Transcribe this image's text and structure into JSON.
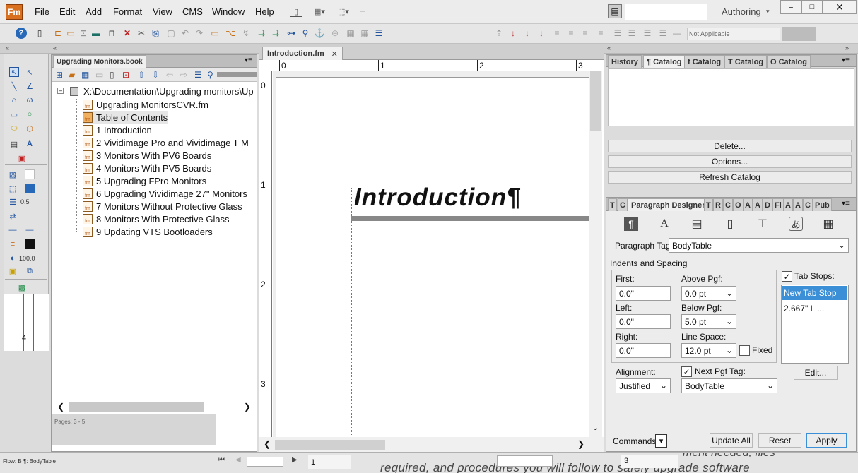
{
  "menubar": {
    "logo": "Fm",
    "items": [
      "File",
      "Edit",
      "Add",
      "Format",
      "View",
      "CMS",
      "Window",
      "Help"
    ],
    "workspace": "Authoring"
  },
  "toolbar": {
    "not_applicable": "Not Applicable"
  },
  "book": {
    "tab_label": "Upgrading Monitors.book",
    "root": "X:\\Documentation\\Upgrading monitors\\Up",
    "items": [
      "Upgrading MonitorsCVR.fm",
      "Table of Contents",
      "1 Introduction",
      "2 Vividimage Pro and Vividimage T M",
      "3 Monitors With PV6 Boards",
      "4 Monitors With PV5 Boards",
      "5 Upgrading FPro Monitors",
      "6 Upgrading Vividimage 27\" Monitors",
      "7 Monitors Without Protective Glass",
      "8 Monitors With Protective Glass",
      "9 Updating VTS Bootloaders"
    ],
    "status": "Pages: 3 - 5"
  },
  "tools": {
    "line_width": "0.5",
    "zoom": "100.0",
    "ruler_mark": "4"
  },
  "document": {
    "tab_label": "Introduction.fm",
    "ruler_h": [
      "0",
      "1",
      "2",
      "3"
    ],
    "ruler_v": [
      "0",
      "1",
      "2",
      "3"
    ],
    "heading": "Introduction¶"
  },
  "right_top": {
    "tabs": [
      "History",
      "¶ Catalog",
      "f Catalog",
      "T Catalog",
      "O Catalog"
    ],
    "buttons": [
      "Delete...",
      "Options...",
      "Refresh Catalog"
    ]
  },
  "pgf": {
    "tab_label": "Paragraph Designer",
    "other_tabs": [
      "T",
      "C",
      "T",
      "R",
      "C",
      "O",
      "A",
      "A",
      "D",
      "Fi",
      "A",
      "A",
      "C",
      "Pub"
    ],
    "tag_label": "Paragraph Tag:",
    "tag_value": "BodyTable",
    "section": "Indents and Spacing",
    "first_label": "First:",
    "first": "0.0\"",
    "left_label": "Left:",
    "left": "0.0\"",
    "right_label": "Right:",
    "right": "0.0\"",
    "above_label": "Above Pgf:",
    "above": "0.0 pt",
    "below_label": "Below Pgf:",
    "below": "5.0 pt",
    "line_label": "Line Space:",
    "line": "12.0 pt",
    "fixed_label": "Fixed",
    "tab_stops_label": "Tab Stops:",
    "tab_stops": [
      "New Tab Stop",
      "2.667\"  L  ..."
    ],
    "edit_label": "Edit...",
    "align_label": "Alignment:",
    "align_value": "Justified",
    "next_label": "Next Pgf Tag:",
    "next_value": "BodyTable",
    "commands_label": "Commands:",
    "update_all": "Update All",
    "reset": "Reset",
    "apply": "Apply"
  },
  "statusbar": {
    "flow": "Flow: B  ¶: BodyTable",
    "page_field": "1",
    "page_count": "3",
    "bg_text": "required, and procedures you will follow to safely upgrade software",
    "bg_text2": "ment needed, files"
  }
}
